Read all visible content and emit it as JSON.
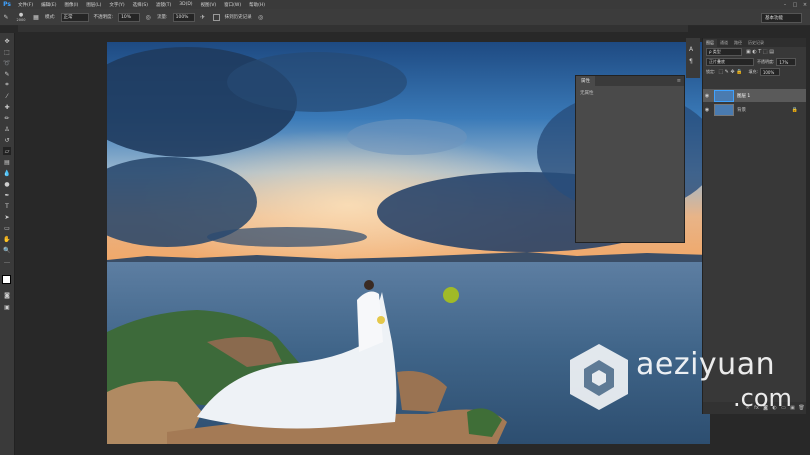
{
  "app": {
    "logo": "Ps"
  },
  "menu": {
    "items": [
      "文件(F)",
      "编辑(E)",
      "图像(I)",
      "图层(L)",
      "文字(Y)",
      "选择(S)",
      "滤镜(T)",
      "3D(D)",
      "视图(V)",
      "窗口(W)",
      "帮助(H)"
    ],
    "window_controls": [
      "–",
      "□",
      "×"
    ]
  },
  "options_bar": {
    "brush_size": "2000",
    "mode_label": "模式:",
    "mode_value": "正常",
    "opacity_label": "不透明度:",
    "opacity_value": "10%",
    "flow_label": "流量:",
    "flow_value": "100%",
    "history_label": "抹到历史记录",
    "workspace": "基本功能"
  },
  "properties_panel": {
    "tab": "属性",
    "subtitle": "无属性",
    "collapse": "»"
  },
  "layers_panel": {
    "tabs": [
      "图层",
      "通道",
      "路径",
      "历史记录"
    ],
    "kind_filter": "ρ 类型",
    "blend_mode": "正片叠底",
    "opacity_label": "不透明度:",
    "opacity_value": "17%",
    "lock_label": "锁定:",
    "fill_label": "填充:",
    "fill_value": "100%",
    "layers": [
      {
        "name": "图层 1",
        "selected": true
      },
      {
        "name": "背景",
        "selected": false,
        "locked": true
      }
    ]
  },
  "watermark": {
    "line1": "aeziyuan",
    "line2": ".com"
  },
  "colors": {
    "ui_bg": "#282828",
    "panel": "#383838",
    "accent_blue": "#3fa2ff",
    "cursor": "#a9c21b"
  }
}
